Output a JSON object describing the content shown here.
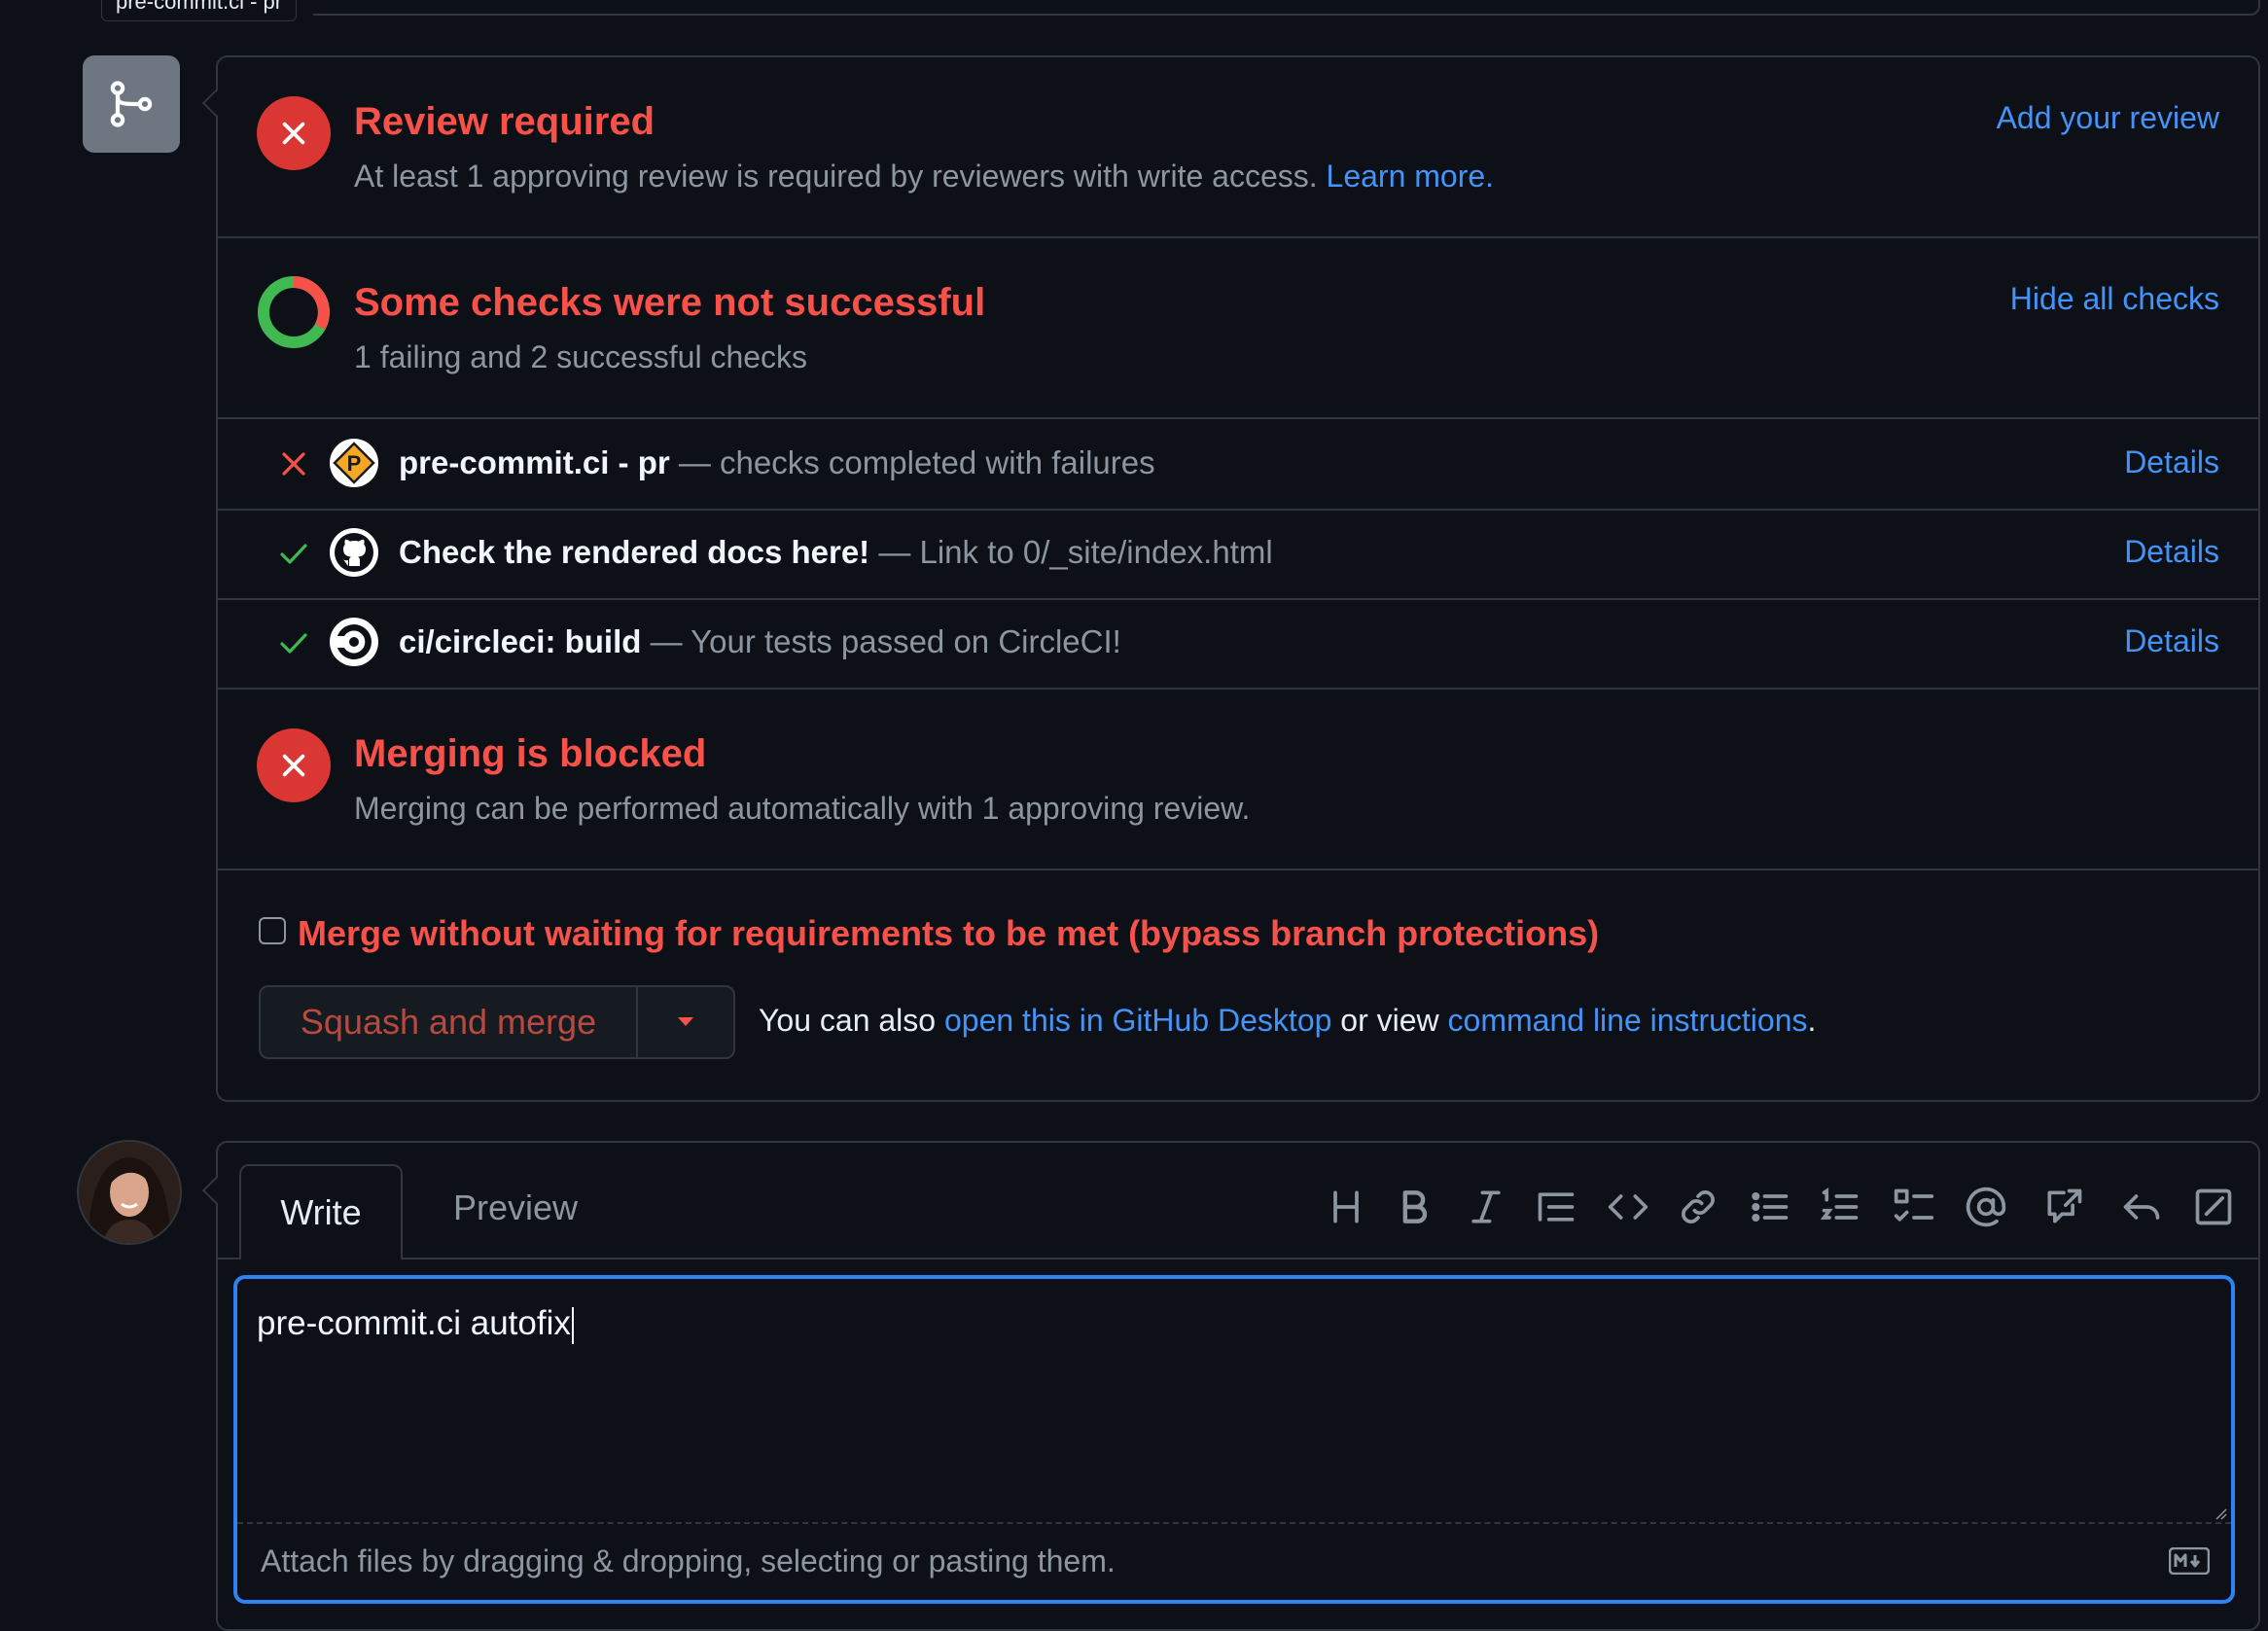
{
  "tooltip": "pre-commit.ci - pr",
  "review": {
    "title": "Review required",
    "desc": "At least 1 approving review is required by reviewers with write access.",
    "learn_more": "Learn more.",
    "action": "Add your review"
  },
  "checks": {
    "title": "Some checks were not successful",
    "summary": "1 failing and 2 successful checks",
    "action": "Hide all checks",
    "items": [
      {
        "name": "pre-commit.ci - pr",
        "desc": "— checks completed with failures",
        "status": "failure",
        "details": "Details",
        "logo": "pre-commit-logo"
      },
      {
        "name": "Check the rendered docs here!",
        "desc": "— Link to 0/_site/index.html",
        "status": "success",
        "details": "Details",
        "logo": "github-logo"
      },
      {
        "name": "ci/circleci: build",
        "desc": "— Your tests passed on CircleCI!",
        "status": "success",
        "details": "Details",
        "logo": "circleci-logo"
      }
    ]
  },
  "merge_block": {
    "title": "Merging is blocked",
    "desc": "Merging can be performed automatically with 1 approving review."
  },
  "bypass": {
    "label": "Merge without waiting for requirements to be met (bypass branch protections)",
    "checked": false
  },
  "merge_action": {
    "button": "Squash and merge",
    "also_prefix": "You can also",
    "desktop_link": "open this in GitHub Desktop",
    "or_view": "or view",
    "cli_link": "command line instructions",
    "period": "."
  },
  "comment": {
    "tab_write": "Write",
    "tab_preview": "Preview",
    "text": "pre-commit.ci autofix",
    "attach": "Attach files by dragging & dropping, selecting or pasting them.",
    "toolbar": [
      "heading-icon",
      "bold-icon",
      "italic-icon",
      "quote-icon",
      "code-icon",
      "link-icon",
      "unordered-list-icon",
      "ordered-list-icon",
      "task-list-icon",
      "mention-icon",
      "cross-reference-icon",
      "reply-icon",
      "fullscreen-icon"
    ]
  },
  "colors": {
    "background": "#0d1117",
    "border": "#30363d",
    "danger": "#f85149",
    "success": "#3fb950",
    "link": "#4493f8",
    "focus": "#2f81f7"
  }
}
